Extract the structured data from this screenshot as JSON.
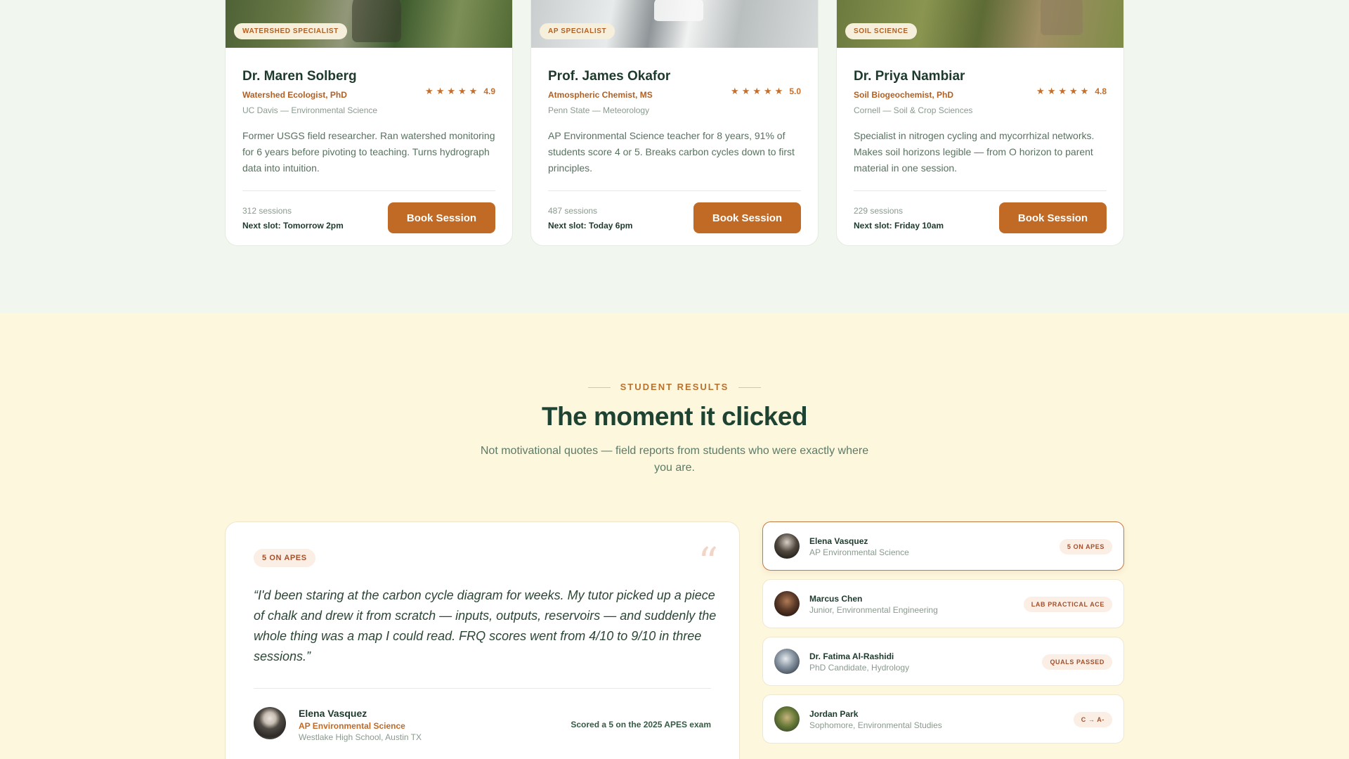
{
  "tutors": [
    {
      "badge": "WATERSHED SPECIALIST",
      "name": "Dr. Maren Solberg",
      "rating": "4.9",
      "role": "Watershed Ecologist, PhD",
      "school": "UC Davis — Environmental Science",
      "bio": "Former USGS field researcher. Ran watershed monitoring for 6 years before pivoting to teaching. Turns hydrograph data into intuition.",
      "sessions": "312 sessions",
      "next_slot": "Next slot: Tomorrow 2pm",
      "button": "Book Session"
    },
    {
      "badge": "AP SPECIALIST",
      "name": "Prof. James Okafor",
      "rating": "5.0",
      "role": "Atmospheric Chemist, MS",
      "school": "Penn State — Meteorology",
      "bio": "AP Environmental Science teacher for 8 years, 91% of students score 4 or 5. Breaks carbon cycles down to first principles.",
      "sessions": "487 sessions",
      "next_slot": "Next slot: Today 6pm",
      "button": "Book Session"
    },
    {
      "badge": "SOIL SCIENCE",
      "name": "Dr. Priya Nambiar",
      "rating": "4.8",
      "role": "Soil Biogeochemist, PhD",
      "school": "Cornell — Soil & Crop Sciences",
      "bio": "Specialist in nitrogen cycling and mycorrhizal networks. Makes soil horizons legible — from O horizon to parent material in one session.",
      "sessions": "229 sessions",
      "next_slot": "Next slot: Friday 10am",
      "button": "Book Session"
    }
  ],
  "star_icon": "star-icon",
  "results": {
    "eyebrow": "STUDENT RESULTS",
    "title": "The moment it clicked",
    "subtitle": "Not motivational quotes — field reports from students who were exactly where you are.",
    "featured": {
      "badge": "5 ON APES",
      "quote_mark": "“",
      "quote": "“I'd been staring at the carbon cycle diagram for weeks. My tutor picked up a piece of chalk and drew it from scratch — inputs, outputs, reservoirs — and suddenly the whole thing was a map I could read. FRQ scores went from 4/10 to 9/10 in three sessions.”",
      "author_name": "Elena Vasquez",
      "author_course": "AP Environmental Science",
      "author_school": "Westlake High School, Austin TX",
      "result": "Scored a 5 on the 2025 APES exam"
    },
    "students": [
      {
        "name": "Elena Vasquez",
        "subtitle": "AP Environmental Science",
        "badge": "5 ON APES",
        "active": true
      },
      {
        "name": "Marcus Chen",
        "subtitle": "Junior, Environmental Engineering",
        "badge": "LAB PRACTICAL ACE",
        "active": false
      },
      {
        "name": "Dr. Fatima Al-Rashidi",
        "subtitle": "PhD Candidate, Hydrology",
        "badge": "QUALS PASSED",
        "active": false
      },
      {
        "name": "Jordan Park",
        "subtitle": "Sophomore, Environmental Studies",
        "badge": "C → A-",
        "active": false
      }
    ]
  },
  "colors": {
    "accent": "#c06a26",
    "dark_green": "#1d3a2c",
    "cream_bg": "#fdf7de",
    "mint_bg": "#f1f6ef"
  }
}
